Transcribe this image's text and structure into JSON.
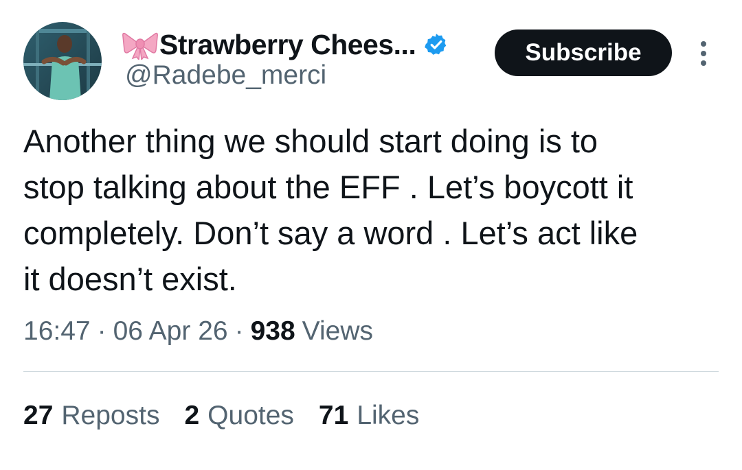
{
  "author": {
    "display_name": "Strawberry Chees...",
    "handle": "@Radebe_merci",
    "name_emoji_icon": "ribbon-bow-icon",
    "verified_icon": "verified-badge-icon",
    "avatar_icon": "profile-photo"
  },
  "actions": {
    "subscribe_label": "Subscribe",
    "more_icon": "more-vertical-icon"
  },
  "tweet": {
    "text": "Another thing we should start doing is to\nstop talking about the EFF . Let’s boycott it\ncompletely. Don’t say a word . Let’s act like\nit doesn’t exist."
  },
  "meta": {
    "time": "16:47",
    "separator": "·",
    "date": "06 Apr 26",
    "views_count": "938",
    "views_label": "Views"
  },
  "stats": [
    {
      "count": "27",
      "label": "Reposts"
    },
    {
      "count": "2",
      "label": "Quotes"
    },
    {
      "count": "71",
      "label": "Likes"
    }
  ],
  "colors": {
    "text_primary": "#0f1419",
    "text_secondary": "#536471",
    "verified_blue": "#1d9bf0",
    "button_bg": "#0f1419",
    "divider": "#cfd9de",
    "bow_pink": "#f4a7c3"
  }
}
